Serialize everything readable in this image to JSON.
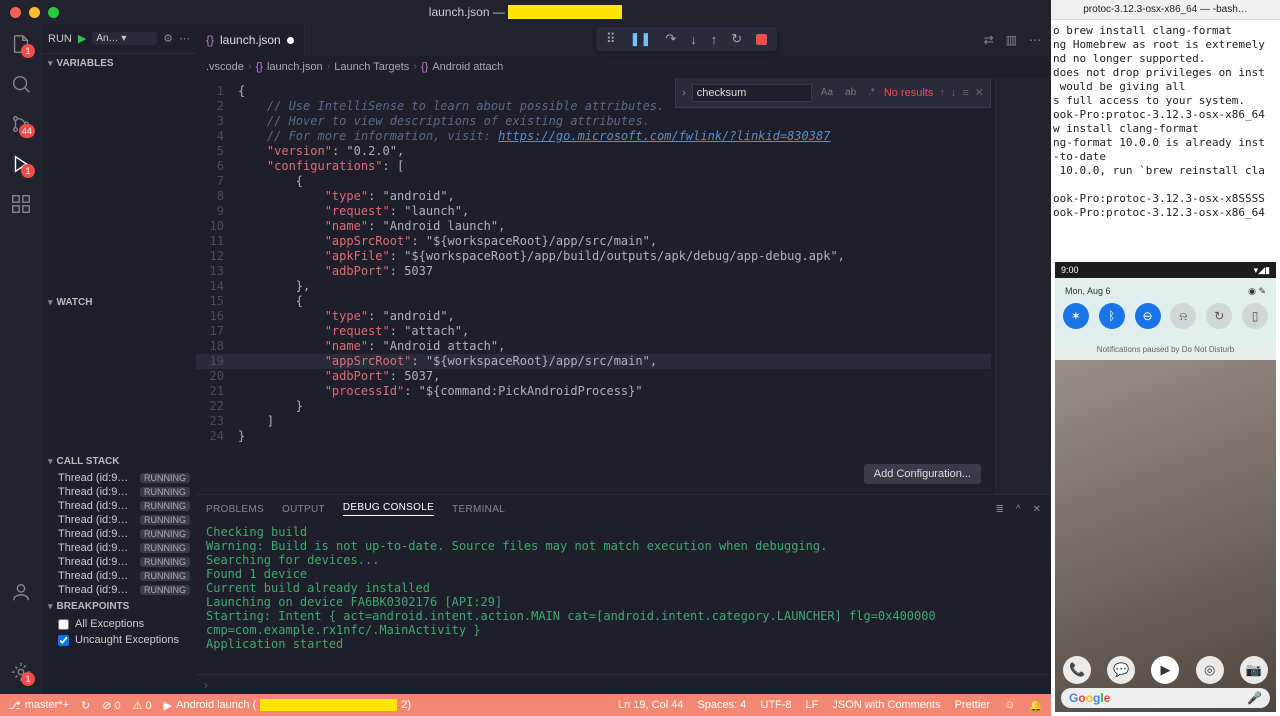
{
  "title": {
    "file": "launch.json",
    "suffix": " — ",
    "redacted": "xxxxxxxxxxxxxxxxxxx"
  },
  "tab": {
    "name": "launch.json"
  },
  "breadcrumbs": [
    ".vscode",
    "launch.json",
    "Launch Targets",
    "Android attach"
  ],
  "debugToolbar": {
    "drag": "⠿",
    "pause": "❚❚",
    "step_over": "↷",
    "step_into": "↓",
    "step_out": "↑",
    "restart": "↻"
  },
  "sidebar": {
    "runLabel": "RUN",
    "configName": "An… ▾",
    "sections": {
      "variables": "VARIABLES",
      "watch": "WATCH",
      "callstack": "CALL STACK",
      "breakpoints": "BREAKPOINTS"
    },
    "threads": [
      {
        "name": "Thread (id:9…",
        "state": "RUNNING"
      },
      {
        "name": "Thread (id:9…",
        "state": "RUNNING"
      },
      {
        "name": "Thread (id:9…",
        "state": "RUNNING"
      },
      {
        "name": "Thread (id:9…",
        "state": "RUNNING"
      },
      {
        "name": "Thread (id:9…",
        "state": "RUNNING"
      },
      {
        "name": "Thread (id:9…",
        "state": "RUNNING"
      },
      {
        "name": "Thread (id:9…",
        "state": "RUNNING"
      },
      {
        "name": "Thread (id:9…",
        "state": "RUNNING"
      },
      {
        "name": "Thread (id:9…",
        "state": "RUNNING"
      }
    ],
    "breakpoints": [
      {
        "label": "All Exceptions",
        "checked": false
      },
      {
        "label": "Uncaught Exceptions",
        "checked": true
      }
    ]
  },
  "find": {
    "value": "checksum",
    "result": "No results"
  },
  "code": {
    "lines": [
      "{",
      "    // Use IntelliSense to learn about possible attributes.",
      "    // Hover to view descriptions of existing attributes.",
      "    // For more information, visit: https://go.microsoft.com/fwlink/?linkid=830387",
      "    \"version\": \"0.2.0\",",
      "    \"configurations\": [",
      "        {",
      "            \"type\": \"android\",",
      "            \"request\": \"launch\",",
      "            \"name\": \"Android launch\",",
      "            \"appSrcRoot\": \"${workspaceRoot}/app/src/main\",",
      "            \"apkFile\": \"${workspaceRoot}/app/build/outputs/apk/debug/app-debug.apk\",",
      "            \"adbPort\": 5037",
      "        },",
      "        {",
      "            \"type\": \"android\",",
      "            \"request\": \"attach\",",
      "            \"name\": \"Android attach\",",
      "            \"appSrcRoot\": \"${workspaceRoot}/app/src/main\",",
      "            \"adbPort\": 5037,",
      "            \"processId\": \"${command:PickAndroidProcess}\"",
      "        }",
      "    ]",
      "}"
    ],
    "commentLines": [
      2,
      3,
      4
    ],
    "highlightLine": 19
  },
  "addConfigBtn": "Add Configuration...",
  "panel": {
    "tabs": [
      "PROBLEMS",
      "OUTPUT",
      "DEBUG CONSOLE",
      "TERMINAL"
    ],
    "active": 2,
    "lines": [
      "Checking build",
      "Warning: Build is not up-to-date. Source files may not match execution when debugging.",
      "Searching for devices...",
      "Found 1 device",
      "Current build already installed",
      "Launching on device FA6BK0302176 [API:29]",
      "Starting: Intent { act=android.intent.action.MAIN cat=[android.intent.category.LAUNCHER] flg=0x400000 cmp=com.example.rx1nfc/.MainActivity }",
      "Application started"
    ]
  },
  "status": {
    "branch": "master*+",
    "sync": "↻",
    "errors": "⊘ 0",
    "warnings": "⚠ 0",
    "launch_prefix": "Android launch (",
    "launch_suffix": "2)",
    "cursor": "Ln 19, Col 44",
    "spaces": "Spaces: 4",
    "enc": "UTF-8",
    "eol": "LF",
    "lang": "JSON with Comments",
    "prettier": "Prettier",
    "feedback": "☺",
    "bell": "🔔"
  },
  "terminal": {
    "title": "protoc-3.12.3-osx-x86_64 — -bash…",
    "lines": [
      "o brew install clang-format",
      "ng Homebrew as root is extremely",
      "nd no longer supported.",
      "does not drop privileges on inst",
      " would be giving all",
      "s full access to your system.",
      "ook-Pro:protoc-3.12.3-osx-x86_64",
      "w install clang-format",
      "ng-format 10.0.0 is already inst",
      "-to-date",
      " 10.0.0, run `brew reinstall cla",
      "",
      "ook-Pro:protoc-3.12.3-osx-x8SSSS",
      "ook-Pro:protoc-3.12.3-osx-x86_64"
    ]
  },
  "emulator": {
    "time": "9:00",
    "date": "Mon, Aug 6",
    "dnd": "Notifications paused by Do Not Disturb",
    "qs": [
      "wifi",
      "bt",
      "dnd",
      "flash",
      "rotate",
      "batt"
    ]
  },
  "badges": {
    "explorer": "1",
    "scm": "44",
    "debug": "1",
    "bottom": "1"
  }
}
